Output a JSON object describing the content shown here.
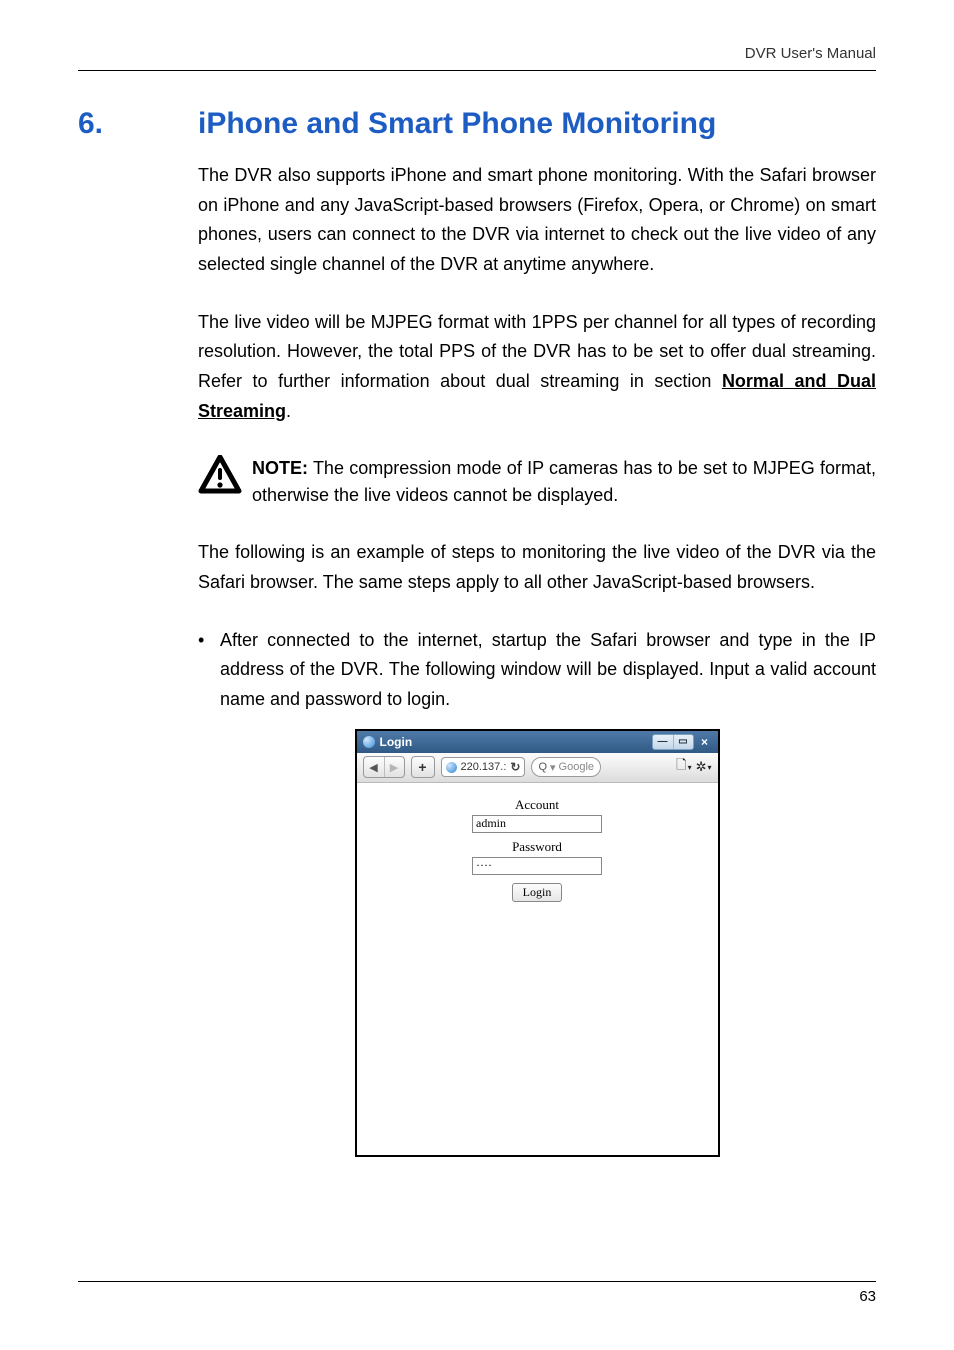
{
  "header": {
    "manual_label": "DVR User's Manual"
  },
  "section": {
    "number": "6.",
    "title": "iPhone and Smart Phone Monitoring"
  },
  "paragraphs": {
    "p1": "The DVR also supports iPhone and smart phone monitoring. With the Safari browser on iPhone and any JavaScript-based browsers (Firefox, Opera, or Chrome) on smart phones, users can connect to the DVR via internet to check out the live video of any selected single channel of the DVR at anytime anywhere.",
    "p2_pre": "The live video will be MJPEG format with 1PPS per channel for all types of recording resolution. However, the total PPS of the DVR has to be set to offer dual streaming. Refer to further information about dual streaming in section ",
    "p2_link": "Normal and Dual Streaming",
    "p2_post": ".",
    "note_label": "NOTE:",
    "note_text": " The compression mode of IP cameras has to be set to MJPEG format, otherwise the live videos cannot be displayed.",
    "p3": "The following is an example of steps to monitoring the live video of the DVR via the Safari browser. The same steps apply to all other JavaScript-based browsers.",
    "bullet1": "After connected to the internet, startup the Safari browser and type in the IP address of the DVR. The following window will be displayed. Input a valid account name and password to login."
  },
  "screenshot": {
    "window_title": "Login",
    "address_text": "220.137.:",
    "search_placeholder": "Google",
    "account_label": "Account",
    "account_value": "admin",
    "password_label": "Password",
    "password_value": "····",
    "login_button": "Login",
    "window_btn_min": "—",
    "window_btn_max": "▭",
    "window_btn_close": "×",
    "nav_back": "◀",
    "nav_fwd": "▶",
    "plus": "+",
    "reload": "↻",
    "magnifier": "🔍",
    "page_icon": "🗋",
    "gear_icon": "✲",
    "dropdown_tri": "▾",
    "search_tri": "▾"
  },
  "footer": {
    "page_number": "63"
  }
}
